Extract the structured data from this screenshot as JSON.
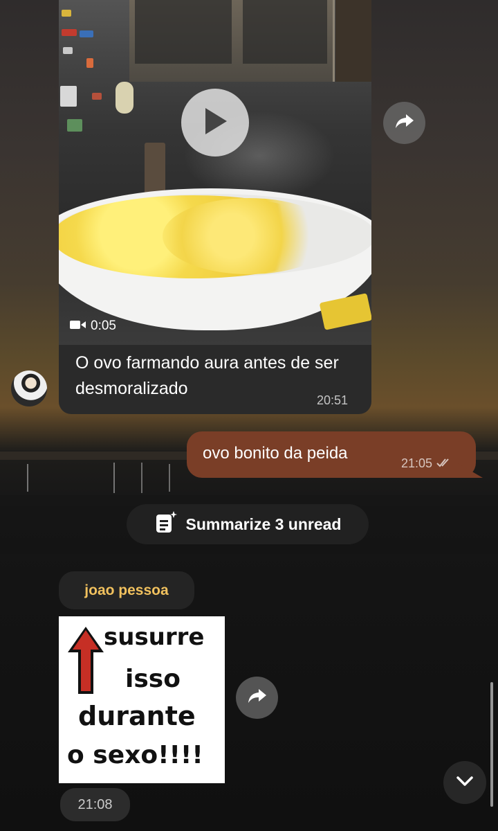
{
  "video_message": {
    "duration": "0:05",
    "caption": "O ovo farmando aura antes de ser desmoralizado",
    "time": "20:51"
  },
  "outgoing_message": {
    "text": "ovo bonito da peida",
    "time": "21:05",
    "status": "read"
  },
  "summarize": {
    "label": "Summarize 3 unread",
    "icon": "summary-document-icon"
  },
  "sticker_message": {
    "sender": "joao pessoa",
    "sticker_lines": [
      "susurre",
      "isso",
      "durante",
      "o sexo!!!!"
    ],
    "time": "21:08"
  },
  "colors": {
    "outgoing_bubble": "#7a3e27",
    "sender_name": "#f1c15e",
    "incoming_bubble": "#2a2a2a",
    "arrow_red": "#c62f25"
  }
}
